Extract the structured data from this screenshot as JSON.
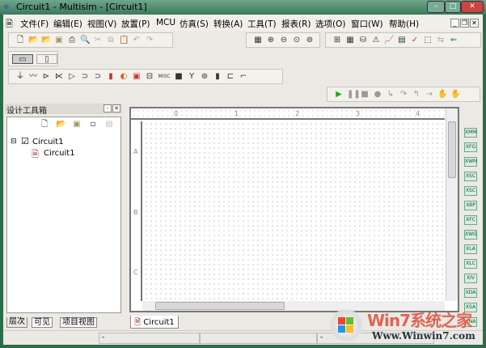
{
  "window": {
    "title": "Circuit1 - Multisim - [Circuit1]"
  },
  "menu": [
    "文件(F)",
    "编辑(E)",
    "视图(V)",
    "放置(P)",
    "MCU",
    "仿真(S)",
    "转换(A)",
    "工具(T)",
    "报表(R)",
    "选项(O)",
    "窗口(W)",
    "帮助(H)"
  ],
  "panel": {
    "title": "设计工具箱",
    "tree": {
      "root": "Circuit1",
      "child": "Circuit1"
    },
    "tabs": [
      "层次",
      "可见",
      "项目视图"
    ]
  },
  "canvas": {
    "col_labels": [
      "0",
      "1",
      "2",
      "3",
      "4"
    ],
    "row_labels": [
      "A",
      "B",
      "C"
    ],
    "tab": "Circuit1"
  },
  "toolbar_components": {
    "misc": "MISC"
  },
  "status": {
    "s1": "-",
    "s2": "-"
  },
  "watermark": {
    "brand": "Win7系统之家",
    "url": "Www.Winwin7.com"
  }
}
